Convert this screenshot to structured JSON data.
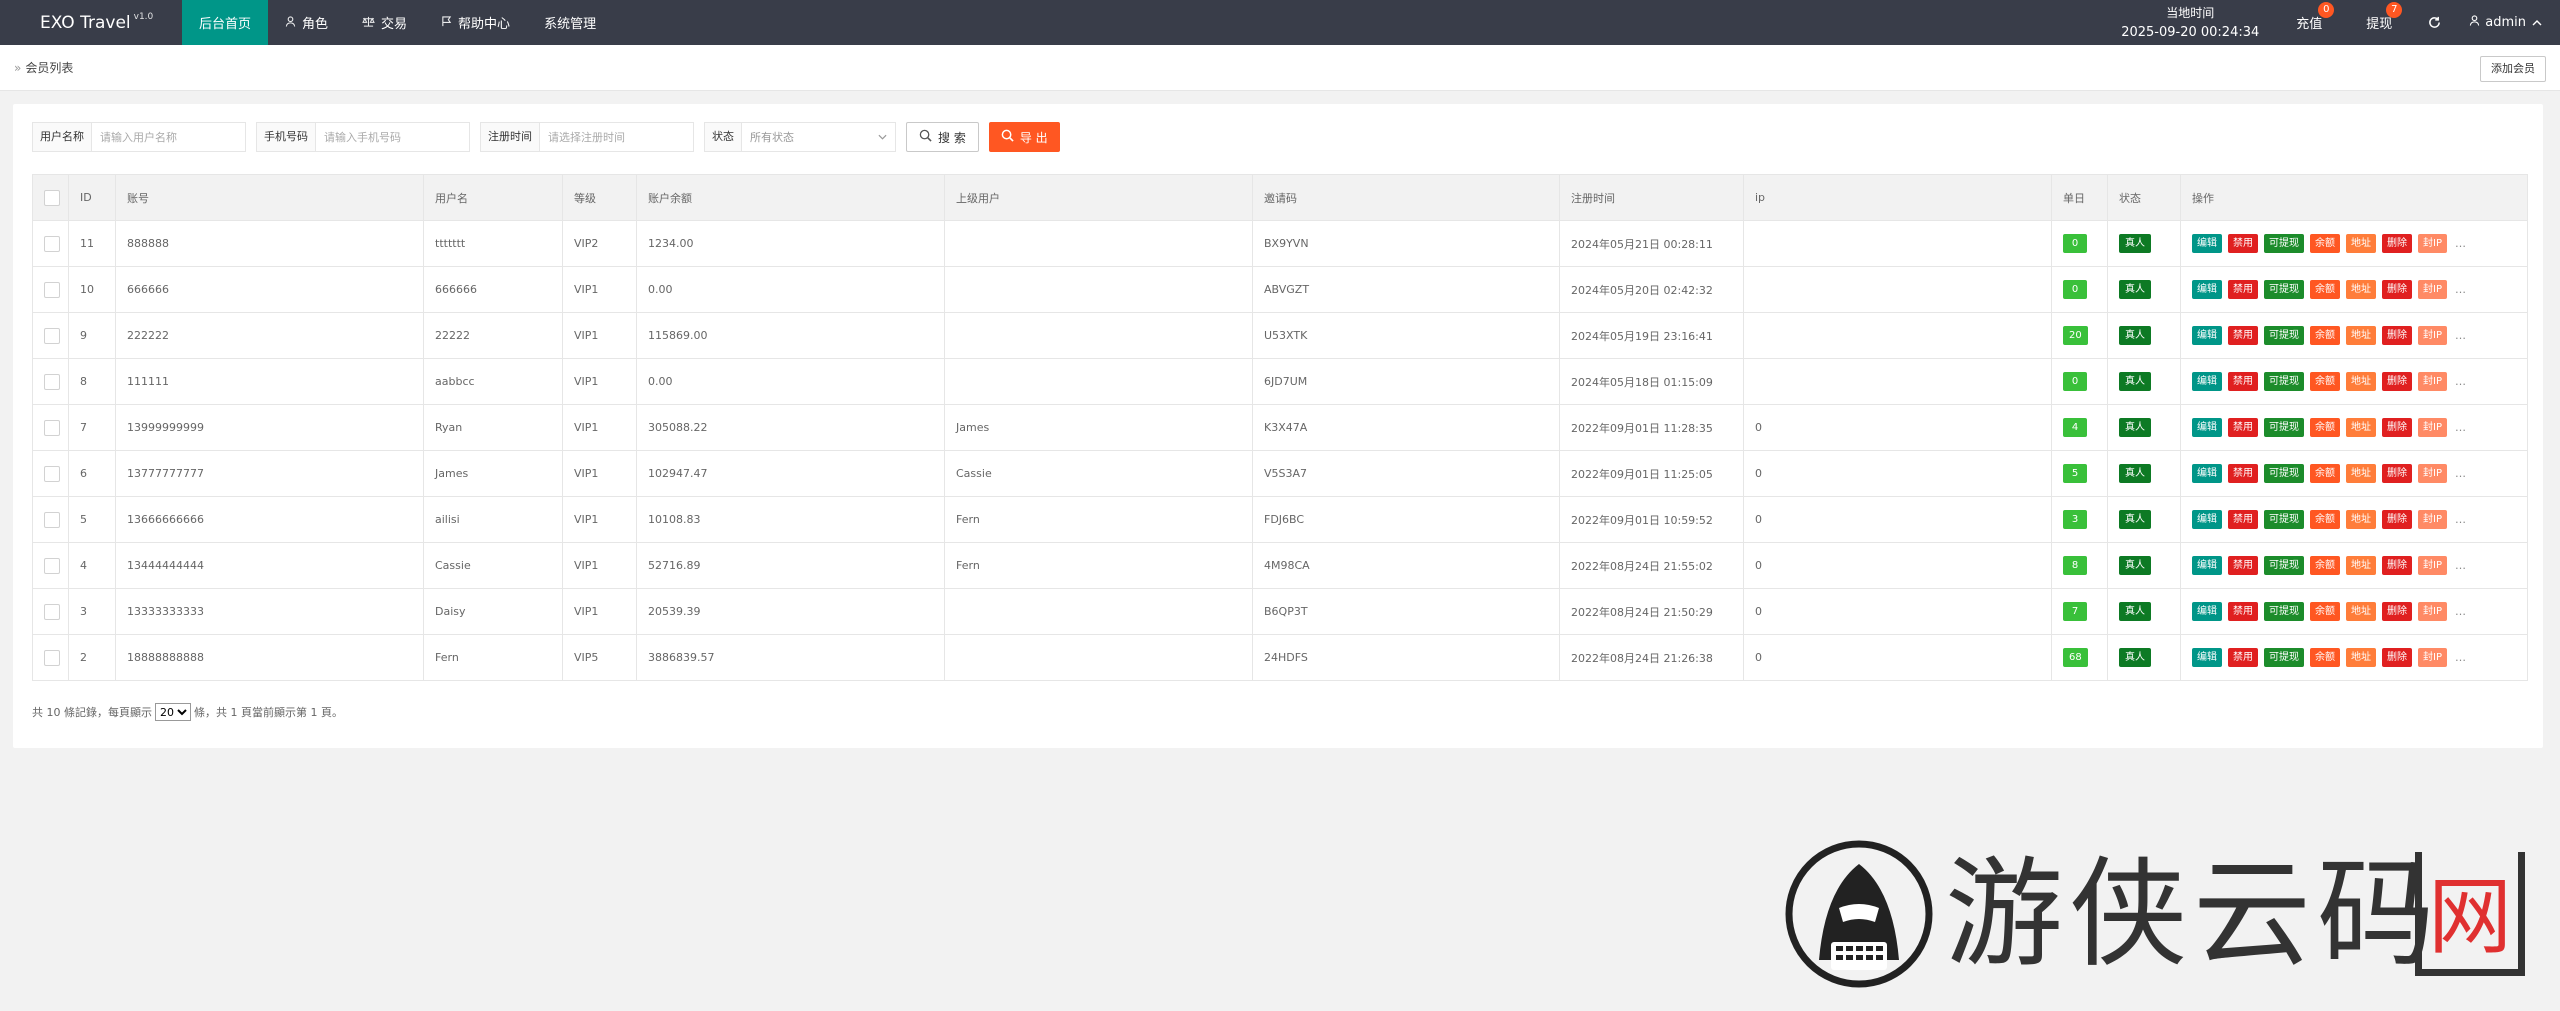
{
  "brand": {
    "name": "EXO Travel",
    "version": "v1.0"
  },
  "nav": [
    {
      "label": "后台首页",
      "icon": "",
      "active": true
    },
    {
      "label": "角色",
      "icon": "user-icon",
      "active": false
    },
    {
      "label": "交易",
      "icon": "scale-icon",
      "active": false
    },
    {
      "label": "帮助中心",
      "icon": "flag-icon",
      "active": false
    },
    {
      "label": "系统管理",
      "icon": "",
      "active": false
    }
  ],
  "topright": {
    "time_label": "当地时间",
    "time_value": "2025-09-20 00:24:34",
    "recharge_label": "充值",
    "recharge_count": "0",
    "withdraw_label": "提现",
    "withdraw_count": "7",
    "refresh_icon": "refresh-icon",
    "user_label": "admin"
  },
  "breadcrumb": {
    "title": "会员列表",
    "add_button": "添加会员"
  },
  "filters": {
    "username_label": "用户名称",
    "username_placeholder": "请输入用户名称",
    "phone_label": "手机号码",
    "phone_placeholder": "请输入手机号码",
    "regtime_label": "注册时间",
    "regtime_placeholder": "请选择注册时间",
    "status_label": "状态",
    "status_value": "所有状态",
    "search_button": "搜 索",
    "export_button": "导 出"
  },
  "table": {
    "headers": [
      "ID",
      "账号",
      "用户名",
      "等级",
      "账户余额",
      "上级用户",
      "邀请码",
      "注册时间",
      "ip",
      "单日",
      "状态",
      "操作"
    ],
    "ops": [
      "编辑",
      "禁用",
      "可提现",
      "余额",
      "地址",
      "删除",
      "封IP"
    ],
    "rows": [
      {
        "id": "11",
        "account": "888888",
        "username": "ttttttt",
        "level": "VIP2",
        "balance": "1234.00",
        "parent": "",
        "invite": "BX9YVN",
        "reg_time": "2024年05月21日 00:28:11",
        "ip": "",
        "daily": "0",
        "status": "真人"
      },
      {
        "id": "10",
        "account": "666666",
        "username": "666666",
        "level": "VIP1",
        "balance": "0.00",
        "parent": "",
        "invite": "ABVGZT",
        "reg_time": "2024年05月20日 02:42:32",
        "ip": "",
        "daily": "0",
        "status": "真人"
      },
      {
        "id": "9",
        "account": "222222",
        "username": "22222",
        "level": "VIP1",
        "balance": "115869.00",
        "parent": "",
        "invite": "U53XTK",
        "reg_time": "2024年05月19日 23:16:41",
        "ip": "",
        "daily": "20",
        "status": "真人"
      },
      {
        "id": "8",
        "account": "111111",
        "username": "aabbcc",
        "level": "VIP1",
        "balance": "0.00",
        "parent": "",
        "invite": "6JD7UM",
        "reg_time": "2024年05月18日 01:15:09",
        "ip": "",
        "daily": "0",
        "status": "真人"
      },
      {
        "id": "7",
        "account": "13999999999",
        "username": "Ryan",
        "level": "VIP1",
        "balance": "305088.22",
        "parent": "James",
        "invite": "K3X47A",
        "reg_time": "2022年09月01日 11:28:35",
        "ip": "0",
        "daily": "4",
        "status": "真人"
      },
      {
        "id": "6",
        "account": "13777777777",
        "username": "James",
        "level": "VIP1",
        "balance": "102947.47",
        "parent": "Cassie",
        "invite": "V5S3A7",
        "reg_time": "2022年09月01日 11:25:05",
        "ip": "0",
        "daily": "5",
        "status": "真人"
      },
      {
        "id": "5",
        "account": "13666666666",
        "username": "ailisi",
        "level": "VIP1",
        "balance": "10108.83",
        "parent": "Fern",
        "invite": "FDJ6BC",
        "reg_time": "2022年09月01日 10:59:52",
        "ip": "0",
        "daily": "3",
        "status": "真人"
      },
      {
        "id": "4",
        "account": "13444444444",
        "username": "Cassie",
        "level": "VIP1",
        "balance": "52716.89",
        "parent": "Fern",
        "invite": "4M98CA",
        "reg_time": "2022年08月24日 21:55:02",
        "ip": "0",
        "daily": "8",
        "status": "真人"
      },
      {
        "id": "3",
        "account": "13333333333",
        "username": "Daisy",
        "level": "VIP1",
        "balance": "20539.39",
        "parent": "",
        "invite": "B6QP3T",
        "reg_time": "2022年08月24日 21:50:29",
        "ip": "0",
        "daily": "7",
        "status": "真人"
      },
      {
        "id": "2",
        "account": "18888888888",
        "username": "Fern",
        "level": "VIP5",
        "balance": "3886839.57",
        "parent": "",
        "invite": "24HDFS",
        "reg_time": "2022年08月24日 21:26:38",
        "ip": "0",
        "daily": "68",
        "status": "真人"
      }
    ]
  },
  "pager": {
    "prefix": "共 10 條記錄，每頁顯示",
    "page_size": "20",
    "suffix": "條，共 1 頁當前顯示第 1 頁。"
  },
  "watermark": {
    "text": "游侠云码",
    "mark": "网"
  },
  "colors": {
    "topbar": "#393d49",
    "accent": "#009688",
    "orange": "#ff5722",
    "green": "#39c03a",
    "dark_green": "#0d7a24"
  }
}
